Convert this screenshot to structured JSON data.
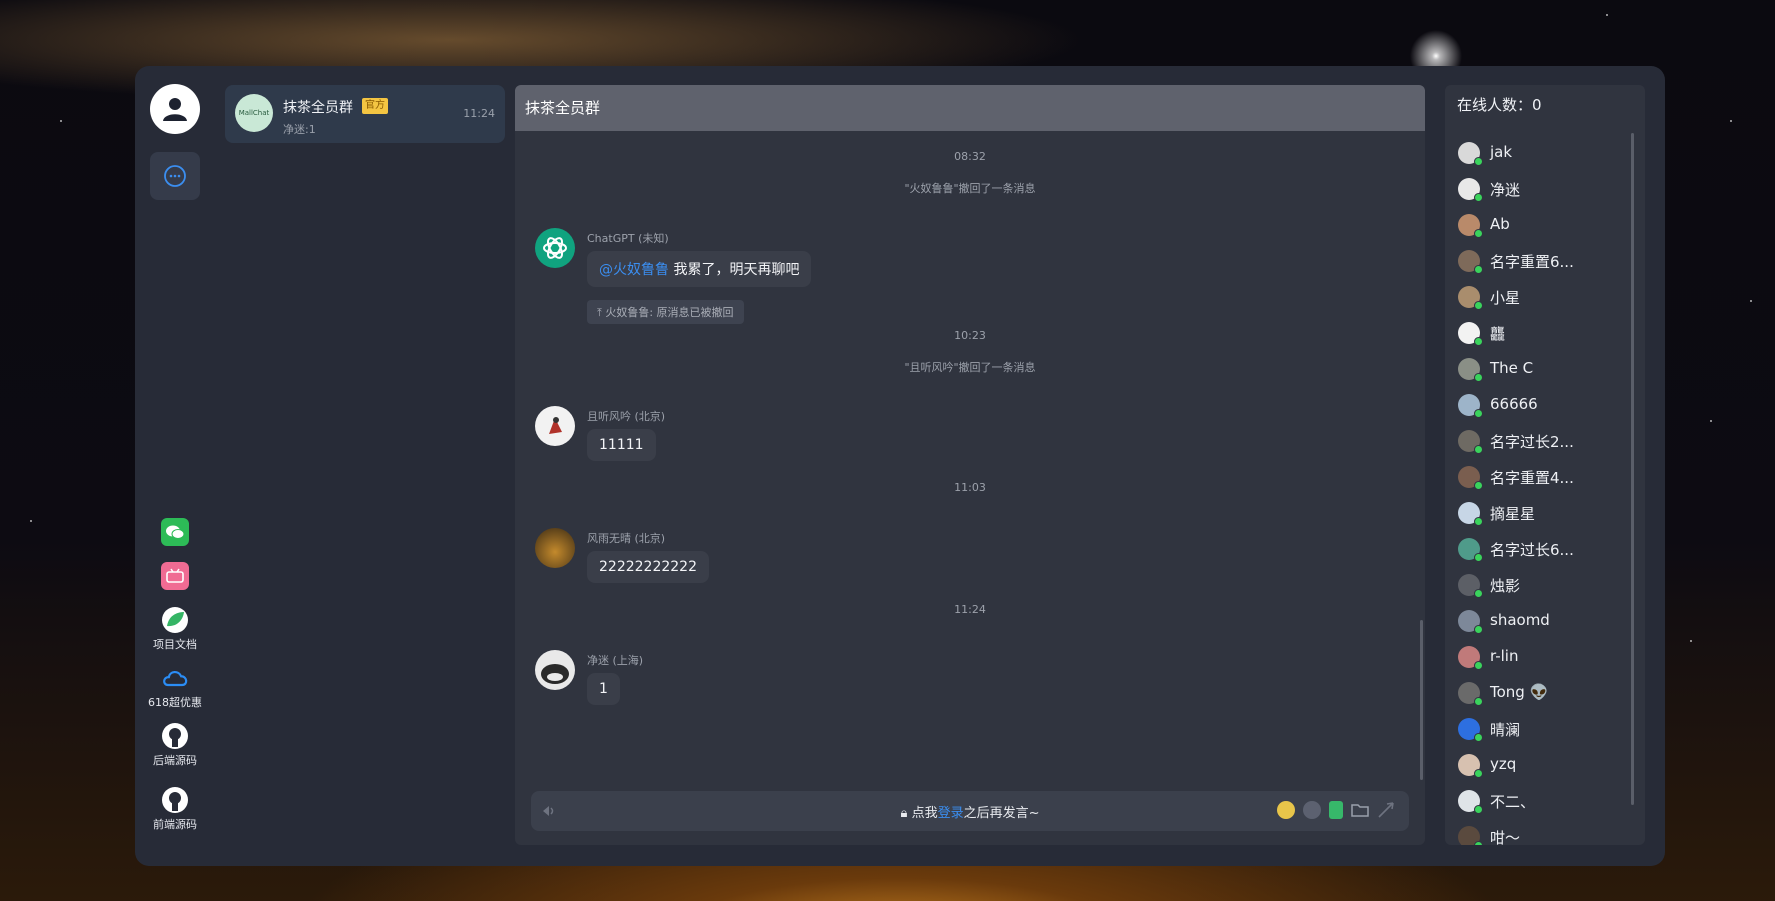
{
  "colors": {
    "accent": "#3b8ef0",
    "online": "#3ad35c",
    "panel": "#30343f",
    "badge": "#f4c542"
  },
  "rail": {
    "avatar_icon": "user-icon",
    "chat_icon": "chat-bubble-icon",
    "links": [
      {
        "label": "",
        "icon": "wechat-icon"
      },
      {
        "label": "",
        "icon": "bilibili-icon"
      },
      {
        "label": "项目文档",
        "icon": "document-leaf-icon"
      },
      {
        "label": "618超优惠",
        "icon": "cloud-icon"
      },
      {
        "label": "后端源码",
        "icon": "github-icon"
      },
      {
        "label": "前端源码",
        "icon": "github-icon"
      }
    ]
  },
  "conversation": {
    "name": "抹茶全员群",
    "badge": "官方",
    "sub": "净迷:1",
    "time": "11:24",
    "avatar_text": "MallChat"
  },
  "chat": {
    "title": "抹茶全员群",
    "ts1": "08:32",
    "sys1": "\"火奴鲁鲁\"撤回了一条消息",
    "m1": {
      "meta": "ChatGPT (未知)",
      "mention": "@火奴鲁鲁",
      "text": " 我累了，明天再聊吧",
      "reply": "火奴鲁鲁: 原消息已被撤回"
    },
    "ts2": "10:23",
    "sys2": "\"且听风吟\"撤回了一条消息",
    "m2": {
      "meta": "且听风吟 (北京)",
      "text": "11111"
    },
    "ts3": "11:03",
    "m3": {
      "meta": "风雨无晴 (北京)",
      "text": "22222222222"
    },
    "ts4": "11:24",
    "m4": {
      "meta": "净迷 (上海)",
      "text": "1"
    }
  },
  "composer": {
    "pre": "点我",
    "login": "登录",
    "post": "之后再发言~"
  },
  "online": {
    "title": "在线人数：0",
    "users": [
      {
        "name": "jak",
        "color": "#d9d9d9"
      },
      {
        "name": "净迷",
        "color": "#e8e8e8"
      },
      {
        "name": "Ab",
        "color": "#b98a6a"
      },
      {
        "name": "名字重置6...",
        "color": "#7e6a5a"
      },
      {
        "name": "小星",
        "color": "#a98d6d"
      },
      {
        "name": "龘",
        "color": "#f2f2f2"
      },
      {
        "name": "The C",
        "color": "#8a8f86"
      },
      {
        "name": "66666",
        "color": "#9db4c9"
      },
      {
        "name": "名字过长2...",
        "color": "#6e6a63"
      },
      {
        "name": "名字重置4...",
        "color": "#7a5e4f"
      },
      {
        "name": "摘星星",
        "color": "#c7d6e6"
      },
      {
        "name": "名字过长6...",
        "color": "#4f9b8a"
      },
      {
        "name": "烛影",
        "color": "#5c5f66"
      },
      {
        "name": "shaomd",
        "color": "#7d8899"
      },
      {
        "name": "r-lin",
        "color": "#c07a7a"
      },
      {
        "name": "Tong 👽",
        "color": "#6a6a6a"
      },
      {
        "name": "晴澜",
        "color": "#2d6fe0"
      },
      {
        "name": "yzq",
        "color": "#d7c1b0"
      },
      {
        "name": "不二、",
        "color": "#dfe4e8"
      },
      {
        "name": "咁～",
        "color": "#5a4a3e"
      }
    ]
  }
}
